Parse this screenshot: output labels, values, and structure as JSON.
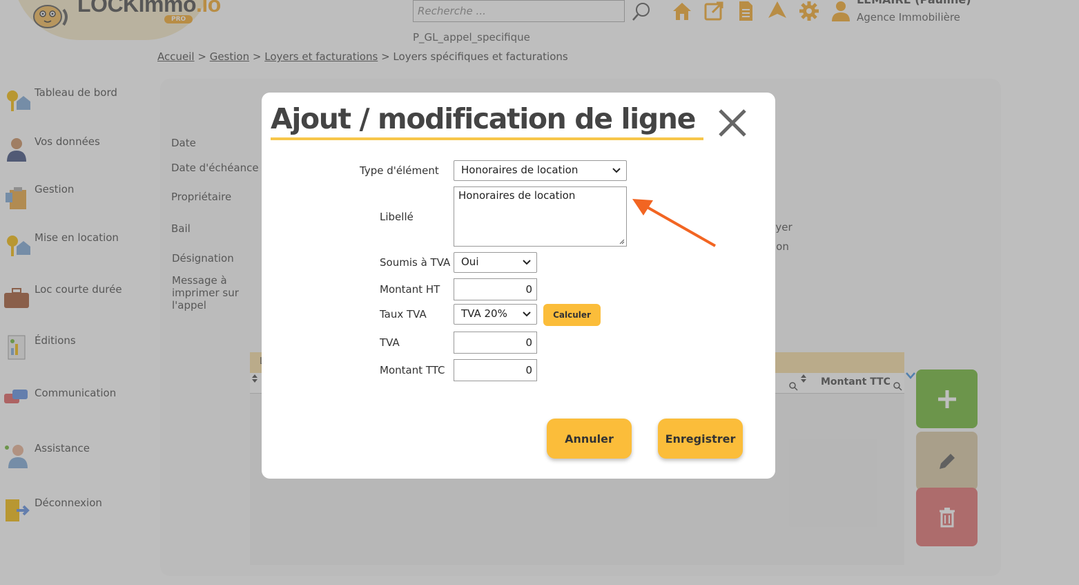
{
  "header": {
    "logo_text": "LOCKimmo",
    "logo_suffix": ".io",
    "logo_badge": "PRO",
    "search_placeholder": "Recherche ...",
    "user_name": "LEMAIRE (Pauline)",
    "user_agency": "Agence Immobilière",
    "page_code": "P_GL_appel_specifique",
    "icons": [
      "home-icon",
      "external-link-icon",
      "document-icon",
      "paper-plane-icon",
      "gear-icon",
      "user-icon"
    ]
  },
  "breadcrumb": {
    "items": [
      "Accueil",
      "Gestion",
      "Loyers et facturations"
    ],
    "separator": ">",
    "current": "Loyers spécifiques et facturations"
  },
  "sidebar": {
    "items": [
      {
        "label": "Tableau de bord",
        "icon": "keys-house-icon"
      },
      {
        "label": "Vos données",
        "icon": "person-icon"
      },
      {
        "label": "Gestion",
        "icon": "clipboard-icon"
      },
      {
        "label": "Mise en location",
        "icon": "keys-icon"
      },
      {
        "label": "Loc courte durée",
        "icon": "suitcase-icon"
      },
      {
        "label": "Éditions",
        "icon": "report-icon"
      },
      {
        "label": "Communication",
        "icon": "chat-bubbles-icon"
      },
      {
        "label": "Assistance",
        "icon": "support-agent-icon"
      },
      {
        "label": "Déconnexion",
        "icon": "logout-icon"
      }
    ]
  },
  "background_form": {
    "labels": [
      "Date",
      "Date d'échéance",
      "Propriétaire",
      "Bail",
      "Désignation",
      "Message à imprimer sur l'appel"
    ],
    "right_text_1": "e loyer",
    "right_text_2": "ion",
    "grid_header_text": "L",
    "grid_column_right": "Montant TTC"
  },
  "modal": {
    "title": "Ajout / modification de ligne",
    "fields": {
      "type_label": "Type d'élément",
      "type_value": "Honoraires de location",
      "libelle_label": "Libellé",
      "libelle_value": "Honoraires de location",
      "tva_soumis_label": "Soumis à TVA",
      "tva_soumis_value": "Oui",
      "montant_ht_label": "Montant HT",
      "montant_ht_value": "0",
      "taux_tva_label": "Taux TVA",
      "taux_tva_value": "TVA 20%",
      "tva_label": "TVA",
      "tva_value": "0",
      "montant_ttc_label": "Montant TTC",
      "montant_ttc_value": "0"
    },
    "calc_button": "Calculer",
    "cancel_button": "Annuler",
    "save_button": "Enregistrer"
  },
  "colors": {
    "accent": "#fbbd3a",
    "underline": "#f7c64a",
    "annotation_arrow": "#f26522",
    "add_button": "#6ab42e",
    "edit_button": "#d9c7a0",
    "delete_button": "#e06a6a"
  }
}
